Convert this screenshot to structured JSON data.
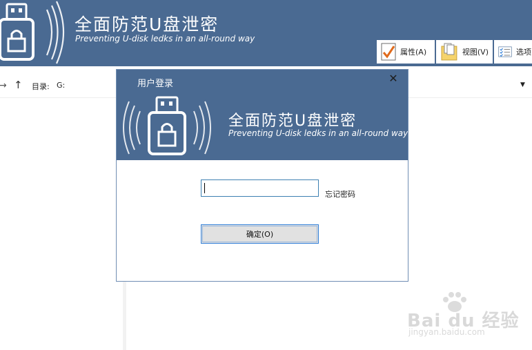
{
  "app": {
    "title": "全面防范U盘泄密",
    "subtitle": "Preventing U-disk ledks in an all-round way"
  },
  "toolbar": {
    "properties_label": "属性(A)",
    "view_label": "视图(V)",
    "options_label": "选项"
  },
  "path_bar": {
    "dir_label": "目录:",
    "dir_value": "G:"
  },
  "dialog": {
    "title": "用户登录",
    "brand_title": "全面防范U盘泄密",
    "brand_subtitle": "Preventing U-disk ledks in an all-round way",
    "password_value": "",
    "forgot_label": "忘记密码",
    "ok_label": "确定(O)"
  },
  "watermark": {
    "text": "Bai du 经验",
    "url": "jingyan.baidu.com"
  },
  "colors": {
    "header_bg": "#4a6a92",
    "focus_border": "#2f7ed8"
  },
  "icons": [
    "usb-lock-icon",
    "checklist-icon",
    "folder-view-icon",
    "options-list-icon",
    "close-icon",
    "forward-arrow-icon",
    "up-arrow-icon",
    "dropdown-arrow-icon"
  ]
}
